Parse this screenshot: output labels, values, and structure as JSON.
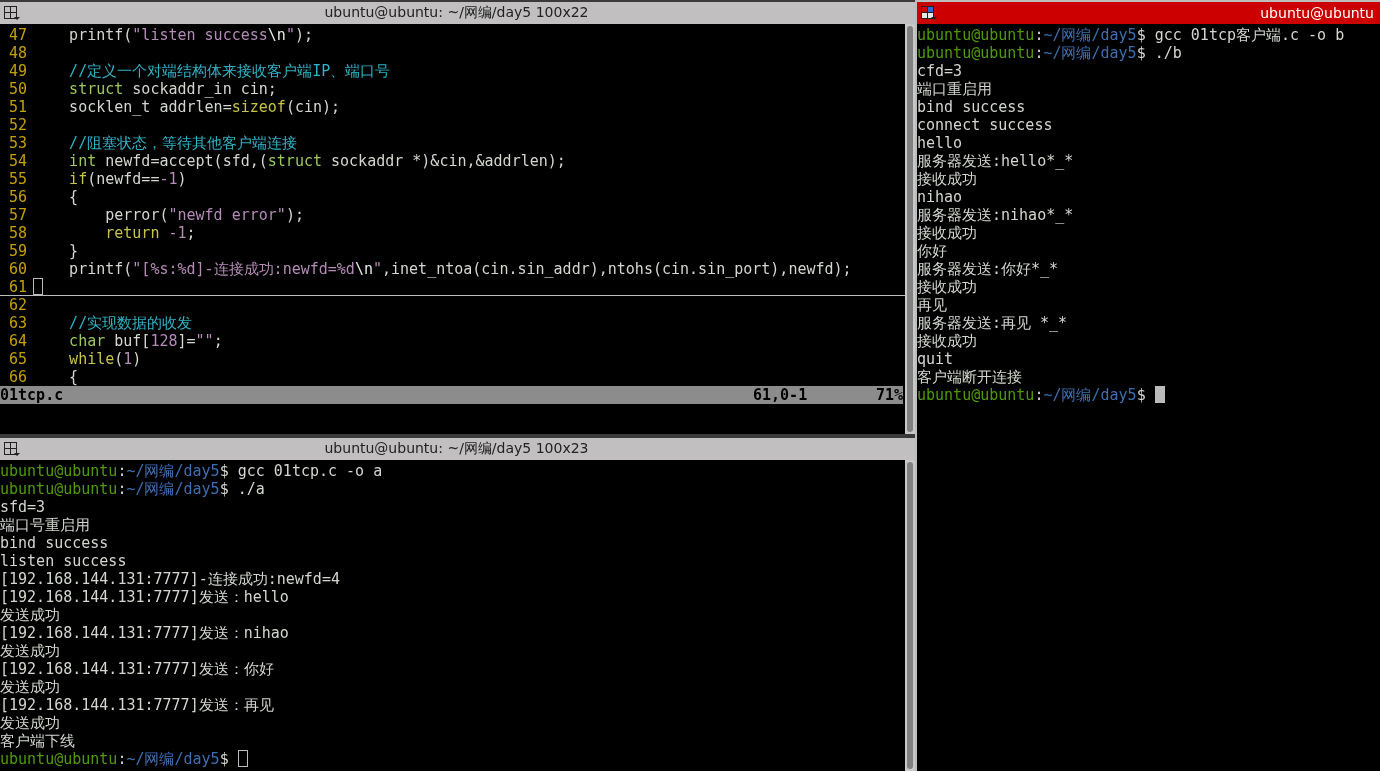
{
  "top_left_pane": {
    "kind": "vim",
    "title": "ubuntu@ubuntu: ~/网编/day5 100x22",
    "active": false,
    "lines": [
      {
        "number": "47",
        "current": false,
        "segments": [
          {
            "text": "    printf(",
            "kind": "plain"
          },
          {
            "text": "\"listen success",
            "kind": "string"
          },
          {
            "text": "\\n",
            "kind": "special"
          },
          {
            "text": "\"",
            "kind": "string"
          },
          {
            "text": ");",
            "kind": "plain"
          }
        ]
      },
      {
        "number": "48",
        "current": false
      },
      {
        "number": "49",
        "current": false,
        "segments": [
          {
            "text": "    //定义一个对端结构体来接收客户端IP、端口号",
            "kind": "comment"
          }
        ]
      },
      {
        "number": "50",
        "current": false,
        "segments": [
          {
            "text": "    struct",
            "kind": "type"
          },
          {
            "text": " sockaddr_in cin;",
            "kind": "plain"
          }
        ]
      },
      {
        "number": "51",
        "current": false,
        "segments": [
          {
            "text": "    socklen_t addrlen=",
            "kind": "plain"
          },
          {
            "text": "sizeof",
            "kind": "keyword"
          },
          {
            "text": "(cin);",
            "kind": "plain"
          }
        ]
      },
      {
        "number": "52",
        "current": false
      },
      {
        "number": "53",
        "current": false,
        "segments": [
          {
            "text": "    //阻塞状态，等待其他客户端连接",
            "kind": "comment"
          }
        ]
      },
      {
        "number": "54",
        "current": false,
        "segments": [
          {
            "text": "    int",
            "kind": "type"
          },
          {
            "text": " newfd=accept(sfd,(",
            "kind": "plain"
          },
          {
            "text": "struct",
            "kind": "type"
          },
          {
            "text": " sockaddr *)&cin,&addrlen);",
            "kind": "plain"
          }
        ]
      },
      {
        "number": "55",
        "current": false,
        "segments": [
          {
            "text": "    if",
            "kind": "keyword"
          },
          {
            "text": "(newfd==",
            "kind": "plain"
          },
          {
            "text": "-1",
            "kind": "number"
          },
          {
            "text": ")",
            "kind": "plain"
          }
        ]
      },
      {
        "number": "56",
        "current": false,
        "segments": [
          {
            "text": "    {",
            "kind": "plain"
          }
        ]
      },
      {
        "number": "57",
        "current": false,
        "segments": [
          {
            "text": "        perror(",
            "kind": "plain"
          },
          {
            "text": "\"newfd error\"",
            "kind": "string"
          },
          {
            "text": ");",
            "kind": "plain"
          }
        ]
      },
      {
        "number": "58",
        "current": false,
        "segments": [
          {
            "text": "        return",
            "kind": "keyword"
          },
          {
            "text": " -1",
            "kind": "number"
          },
          {
            "text": ";",
            "kind": "plain"
          }
        ]
      },
      {
        "number": "59",
        "current": false,
        "segments": [
          {
            "text": "    }",
            "kind": "plain"
          }
        ]
      },
      {
        "number": "60",
        "current": false,
        "segments": [
          {
            "text": "    printf(",
            "kind": "plain"
          },
          {
            "text": "\"[%s:%d]-连接成功:newfd=%d",
            "kind": "string"
          },
          {
            "text": "\\n",
            "kind": "special"
          },
          {
            "text": "\"",
            "kind": "string"
          },
          {
            "text": ",inet_ntoa(cin.sin_addr),ntohs(cin.sin_port),newfd);",
            "kind": "plain"
          }
        ]
      },
      {
        "number": "61",
        "current": true
      },
      {
        "number": "62",
        "current": false
      },
      {
        "number": "63",
        "current": false,
        "segments": [
          {
            "text": "    //实现数据的收发",
            "kind": "comment"
          }
        ]
      },
      {
        "number": "64",
        "current": false,
        "segments": [
          {
            "text": "    char",
            "kind": "type"
          },
          {
            "text": " buf[",
            "kind": "plain"
          },
          {
            "text": "128",
            "kind": "number"
          },
          {
            "text": "]=",
            "kind": "plain"
          },
          {
            "text": "\"\"",
            "kind": "string"
          },
          {
            "text": ";",
            "kind": "plain"
          }
        ]
      },
      {
        "number": "65",
        "current": false,
        "segments": [
          {
            "text": "    while",
            "kind": "keyword"
          },
          {
            "text": "(",
            "kind": "plain"
          },
          {
            "text": "1",
            "kind": "number"
          },
          {
            "text": ")",
            "kind": "plain"
          }
        ]
      },
      {
        "number": "66",
        "current": false,
        "segments": [
          {
            "text": "    {",
            "kind": "plain"
          }
        ]
      }
    ],
    "status": {
      "file": "01tcp.c",
      "position": "61,0-1",
      "percent": "71%"
    }
  },
  "bottom_left_pane": {
    "kind": "shell",
    "title": "ubuntu@ubuntu: ~/网编/day5 100x23",
    "active": false,
    "lines": [
      {
        "cursor": false,
        "segments": [
          {
            "text": "ubuntu@ubuntu",
            "kind": "user"
          },
          {
            "text": ":",
            "kind": "plain"
          },
          {
            "text": "~/网编/day5",
            "kind": "path"
          },
          {
            "text": "$ gcc 01tcp.c -o a",
            "kind": "plain"
          }
        ]
      },
      {
        "cursor": false,
        "segments": [
          {
            "text": "ubuntu@ubuntu",
            "kind": "user"
          },
          {
            "text": ":",
            "kind": "plain"
          },
          {
            "text": "~/网编/day5",
            "kind": "path"
          },
          {
            "text": "$ ./a",
            "kind": "plain"
          }
        ]
      },
      {
        "cursor": false,
        "segments": [
          {
            "text": "sfd=3",
            "kind": "plain"
          }
        ]
      },
      {
        "cursor": false,
        "segments": [
          {
            "text": "端口号重启用",
            "kind": "plain"
          }
        ]
      },
      {
        "cursor": false,
        "segments": [
          {
            "text": "bind success",
            "kind": "plain"
          }
        ]
      },
      {
        "cursor": false,
        "segments": [
          {
            "text": "listen success",
            "kind": "plain"
          }
        ]
      },
      {
        "cursor": false,
        "segments": [
          {
            "text": "[192.168.144.131:7777]-连接成功:newfd=4",
            "kind": "plain"
          }
        ]
      },
      {
        "cursor": false,
        "segments": [
          {
            "text": "[192.168.144.131:7777]发送：hello",
            "kind": "plain"
          }
        ]
      },
      {
        "cursor": false,
        "segments": [
          {
            "text": "发送成功",
            "kind": "plain"
          }
        ]
      },
      {
        "cursor": false,
        "segments": [
          {
            "text": "[192.168.144.131:7777]发送：nihao",
            "kind": "plain"
          }
        ]
      },
      {
        "cursor": false,
        "segments": [
          {
            "text": "发送成功",
            "kind": "plain"
          }
        ]
      },
      {
        "cursor": false,
        "segments": [
          {
            "text": "[192.168.144.131:7777]发送：你好",
            "kind": "plain"
          }
        ]
      },
      {
        "cursor": false,
        "segments": [
          {
            "text": "发送成功",
            "kind": "plain"
          }
        ]
      },
      {
        "cursor": false,
        "segments": [
          {
            "text": "[192.168.144.131:7777]发送：再见",
            "kind": "plain"
          }
        ]
      },
      {
        "cursor": false,
        "segments": [
          {
            "text": "发送成功",
            "kind": "plain"
          }
        ]
      },
      {
        "cursor": false,
        "segments": [
          {
            "text": "客户端下线",
            "kind": "plain"
          }
        ]
      },
      {
        "cursor": true,
        "segments": [
          {
            "text": "ubuntu@ubuntu",
            "kind": "user"
          },
          {
            "text": ":",
            "kind": "plain"
          },
          {
            "text": "~/网编/day5",
            "kind": "path"
          },
          {
            "text": "$",
            "kind": "plain"
          }
        ]
      }
    ]
  },
  "right_pane": {
    "kind": "shell",
    "title": "ubuntu@ubuntu",
    "active": true,
    "lines": [
      {
        "cursor": false,
        "segments": [
          {
            "text": "ubuntu@ubuntu",
            "kind": "user"
          },
          {
            "text": ":",
            "kind": "plain"
          },
          {
            "text": "~/网编/day5",
            "kind": "path"
          },
          {
            "text": "$ gcc 01tcp客户端.c -o b",
            "kind": "plain"
          }
        ]
      },
      {
        "cursor": false,
        "segments": [
          {
            "text": "ubuntu@ubuntu",
            "kind": "user"
          },
          {
            "text": ":",
            "kind": "plain"
          },
          {
            "text": "~/网编/day5",
            "kind": "path"
          },
          {
            "text": "$ ./b",
            "kind": "plain"
          }
        ]
      },
      {
        "cursor": false,
        "segments": [
          {
            "text": "cfd=3",
            "kind": "plain"
          }
        ]
      },
      {
        "cursor": false,
        "segments": [
          {
            "text": "端口重启用",
            "kind": "plain"
          }
        ]
      },
      {
        "cursor": false,
        "segments": [
          {
            "text": "bind success",
            "kind": "plain"
          }
        ]
      },
      {
        "cursor": false,
        "segments": [
          {
            "text": "connect success",
            "kind": "plain"
          }
        ]
      },
      {
        "cursor": false,
        "segments": [
          {
            "text": "hello",
            "kind": "plain"
          }
        ]
      },
      {
        "cursor": false,
        "segments": [
          {
            "text": "服务器发送:hello*_*",
            "kind": "plain"
          }
        ]
      },
      {
        "cursor": false,
        "segments": [
          {
            "text": "接收成功",
            "kind": "plain"
          }
        ]
      },
      {
        "cursor": false,
        "segments": [
          {
            "text": "nihao",
            "kind": "plain"
          }
        ]
      },
      {
        "cursor": false,
        "segments": [
          {
            "text": "服务器发送:nihao*_*",
            "kind": "plain"
          }
        ]
      },
      {
        "cursor": false,
        "segments": [
          {
            "text": "接收成功",
            "kind": "plain"
          }
        ]
      },
      {
        "cursor": false,
        "segments": [
          {
            "text": "你好",
            "kind": "plain"
          }
        ]
      },
      {
        "cursor": false,
        "segments": [
          {
            "text": "服务器发送:你好*_*",
            "kind": "plain"
          }
        ]
      },
      {
        "cursor": false,
        "segments": [
          {
            "text": "接收成功",
            "kind": "plain"
          }
        ]
      },
      {
        "cursor": false,
        "segments": [
          {
            "text": "再见",
            "kind": "plain"
          }
        ]
      },
      {
        "cursor": false,
        "segments": [
          {
            "text": "服务器发送:再见 *_*",
            "kind": "plain"
          }
        ]
      },
      {
        "cursor": false,
        "segments": [
          {
            "text": "接收成功",
            "kind": "plain"
          }
        ]
      },
      {
        "cursor": false,
        "segments": [
          {
            "text": "quit",
            "kind": "plain"
          }
        ]
      },
      {
        "cursor": false,
        "segments": [
          {
            "text": "客户端断开连接",
            "kind": "plain"
          }
        ]
      },
      {
        "cursor": true,
        "segments": [
          {
            "text": "ubuntu@ubuntu",
            "kind": "user"
          },
          {
            "text": ":",
            "kind": "plain"
          },
          {
            "text": "~/网编/day5",
            "kind": "path"
          },
          {
            "text": "$",
            "kind": "plain"
          }
        ]
      }
    ]
  }
}
